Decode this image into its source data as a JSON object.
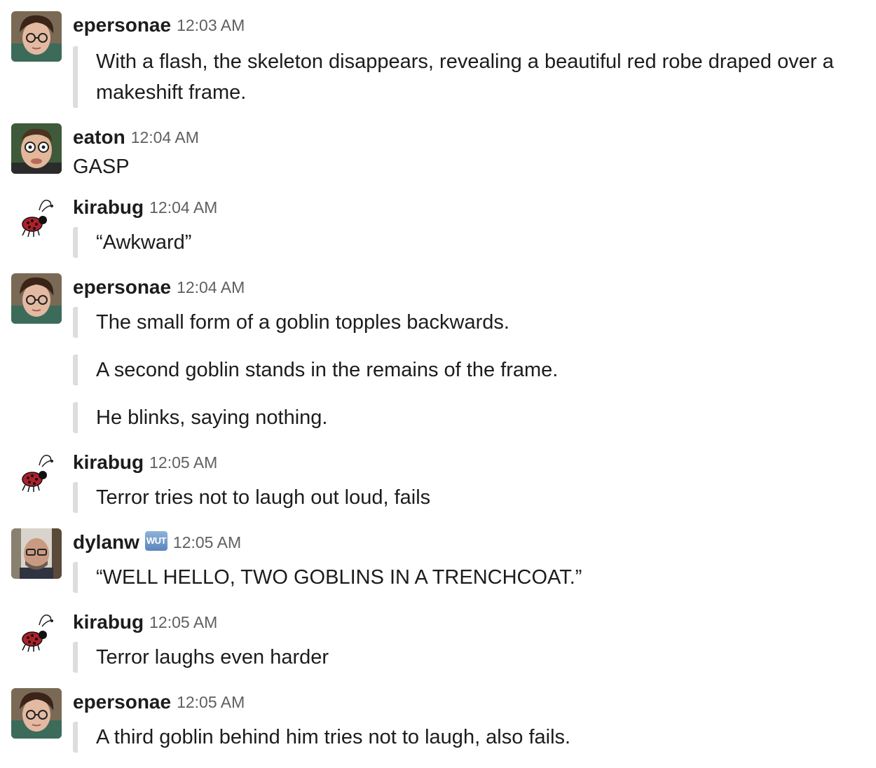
{
  "messages": [
    {
      "author": "epersonae",
      "time": "12:03 AM",
      "avatar": "epersonae-avatar",
      "lines": [
        "With a flash, the skeleton disappears, revealing a beautiful red robe draped over a makeshift frame."
      ]
    },
    {
      "author": "eaton",
      "time": "12:04 AM",
      "avatar": "eaton-avatar",
      "plain": "GASP"
    },
    {
      "author": "kirabug",
      "time": "12:04 AM",
      "avatar": "ladybug-avatar",
      "lines": [
        "“Awkward”"
      ]
    },
    {
      "author": "epersonae",
      "time": "12:04 AM",
      "avatar": "epersonae-avatar",
      "lines": [
        "The small form of a goblin topples backwards.",
        "A second goblin stands in the remains of the frame.",
        "He blinks, saying nothing."
      ]
    },
    {
      "author": "kirabug",
      "time": "12:05 AM",
      "avatar": "ladybug-avatar",
      "lines": [
        "Terror tries not to laugh out loud, fails"
      ]
    },
    {
      "author": "dylanw",
      "badge": "WUT",
      "time": "12:05 AM",
      "avatar": "dylanw-avatar",
      "lines": [
        "“WELL HELLO, TWO GOBLINS IN A TRENCHCOAT.”"
      ]
    },
    {
      "author": "kirabug",
      "time": "12:05 AM",
      "avatar": "ladybug-avatar",
      "lines": [
        "Terror laughs even harder"
      ]
    },
    {
      "author": "epersonae",
      "time": "12:05 AM",
      "avatar": "epersonae-avatar",
      "lines": [
        "A third goblin behind him tries not to laugh, also fails."
      ]
    }
  ],
  "colors": {
    "text": "#1d1c1d",
    "timestamp": "#616061",
    "quote_bar": "#dddddd",
    "badge": "#6f96c8"
  }
}
